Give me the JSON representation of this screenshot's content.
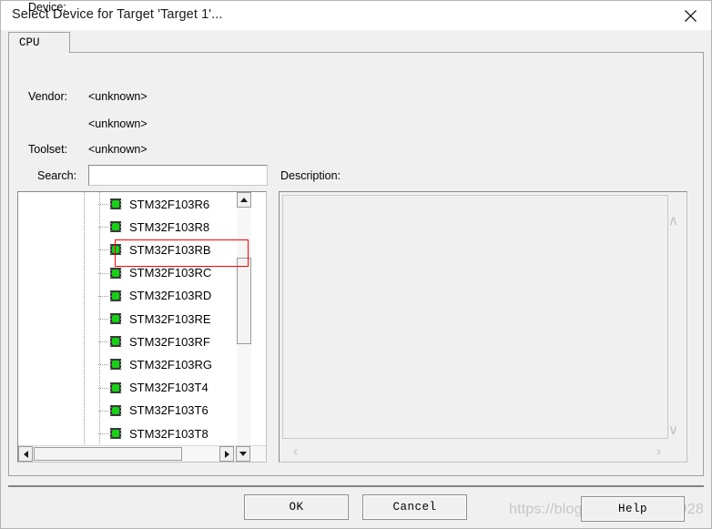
{
  "window": {
    "title": "Select Device for Target 'Target 1'...",
    "close_icon": "close-icon"
  },
  "tabs": [
    {
      "label": "CPU",
      "selected": true
    }
  ],
  "info": {
    "vendor_label": "Vendor:",
    "vendor_value": "<unknown>",
    "device_label": "Device:",
    "device_value": "<unknown>",
    "toolset_label": "Toolset:",
    "toolset_value": "<unknown>"
  },
  "search": {
    "label": "Search:",
    "value": "",
    "placeholder": ""
  },
  "description": {
    "label": "Description:",
    "text": ""
  },
  "device_tree": {
    "items": [
      {
        "label": "STM32F103R6",
        "icon": "chip-icon"
      },
      {
        "label": "STM32F103R8",
        "icon": "chip-icon"
      },
      {
        "label": "STM32F103RB",
        "icon": "chip-icon"
      },
      {
        "label": "STM32F103RC",
        "icon": "chip-icon"
      },
      {
        "label": "STM32F103RD",
        "icon": "chip-icon"
      },
      {
        "label": "STM32F103RE",
        "icon": "chip-icon"
      },
      {
        "label": "STM32F103RF",
        "icon": "chip-icon"
      },
      {
        "label": "STM32F103RG",
        "icon": "chip-icon"
      },
      {
        "label": "STM32F103T4",
        "icon": "chip-icon"
      },
      {
        "label": "STM32F103T6",
        "icon": "chip-icon"
      },
      {
        "label": "STM32F103T8",
        "icon": "chip-icon"
      }
    ],
    "annotation": {
      "color": "#ff0000",
      "targets": "STM32F103RB"
    }
  },
  "buttons": {
    "ok": "OK",
    "cancel": "Cancel",
    "help": "Help"
  },
  "watermark": {
    "text": "https://blog.csdn.net/zby9928"
  },
  "colors": {
    "dialog_background": "#f0f0f0",
    "titlebar_background": "#ffffff",
    "list_background": "#ffffff",
    "annotation": "#ff0000",
    "watermark": "#c6c6c6",
    "chip_green": "#15d215"
  }
}
